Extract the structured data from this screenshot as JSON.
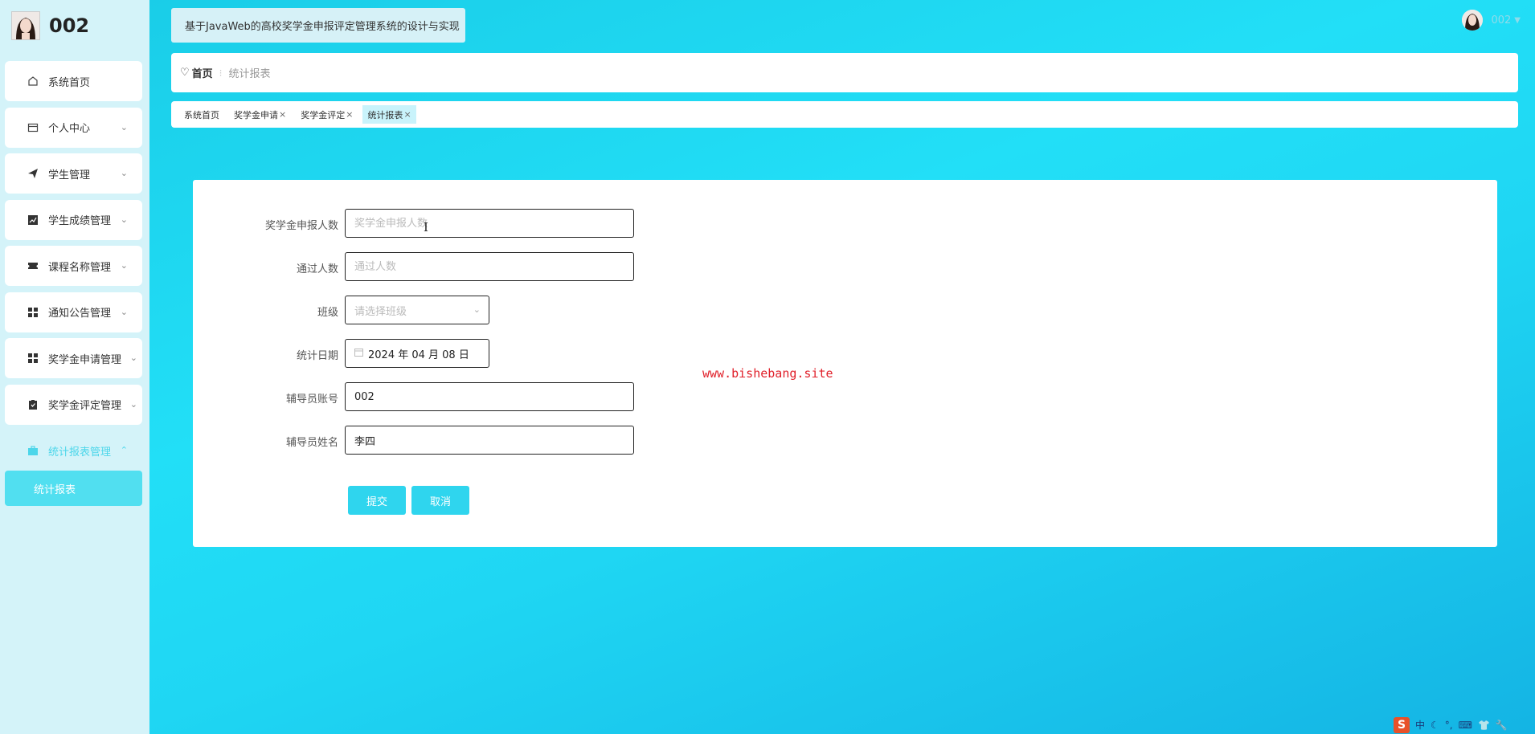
{
  "sidebar": {
    "username": "002",
    "items": [
      {
        "label": "系统首页",
        "icon": "home-icon",
        "expandable": false
      },
      {
        "label": "个人中心",
        "icon": "profile-card-icon",
        "expandable": true
      },
      {
        "label": "学生管理",
        "icon": "paper-plane-icon",
        "expandable": true
      },
      {
        "label": "学生成绩管理",
        "icon": "chart-line-icon",
        "expandable": true
      },
      {
        "label": "课程名称管理",
        "icon": "ticket-icon",
        "expandable": true
      },
      {
        "label": "通知公告管理",
        "icon": "grid-icon",
        "expandable": true
      },
      {
        "label": "奖学金申请管理",
        "icon": "grid-icon",
        "expandable": true
      },
      {
        "label": "奖学金评定管理",
        "icon": "clipboard-icon",
        "expandable": true
      },
      {
        "label": "统计报表管理",
        "icon": "briefcase-icon",
        "expandable": true,
        "open": true
      }
    ],
    "submenu": [
      {
        "label": "统计报表",
        "active": true
      }
    ]
  },
  "header": {
    "system_title": "基于JavaWeb的高校奖学金申报评定管理系统的设计与实现",
    "user_name": "002"
  },
  "breadcrumb": {
    "home": "首页",
    "current": "统计报表"
  },
  "tags": [
    {
      "label": "系统首页",
      "closable": false,
      "active": false
    },
    {
      "label": "奖学金申请",
      "closable": true,
      "active": false
    },
    {
      "label": "奖学金评定",
      "closable": true,
      "active": false
    },
    {
      "label": "统计报表",
      "closable": true,
      "active": true
    }
  ],
  "form": {
    "fields": [
      {
        "label": "奖学金申报人数",
        "placeholder": "奖学金申报人数",
        "value": ""
      },
      {
        "label": "通过人数",
        "placeholder": "通过人数",
        "value": ""
      },
      {
        "label": "班级",
        "placeholder": "请选择班级",
        "value": ""
      },
      {
        "label": "统计日期",
        "value": "2024 年 04 月 08 日"
      },
      {
        "label": "辅导员账号",
        "value": "002"
      },
      {
        "label": "辅导员姓名",
        "value": "李四"
      }
    ],
    "submit_label": "提交",
    "cancel_label": "取消"
  },
  "watermark": "www.bishebang.site",
  "ime": {
    "logo": "S",
    "lang": "中"
  },
  "colors": {
    "accent": "#2fd5ee",
    "sidebar_bg": "#d4f3f9",
    "active_sub": "#51dff0",
    "watermark": "#e0202a"
  }
}
